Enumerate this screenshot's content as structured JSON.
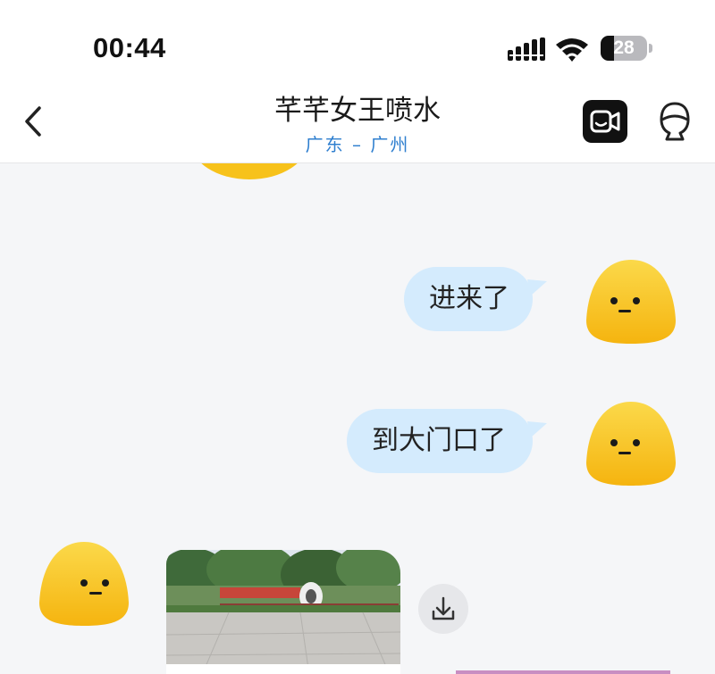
{
  "status_bar": {
    "time": "00:44",
    "battery_level": "28",
    "battery_fraction": 0.28
  },
  "header": {
    "title": "芊芊女王喷水",
    "subtitle": "广东 – 广州",
    "icons": {
      "back": "chevron-left-icon",
      "video": "video-call-icon",
      "profile": "profile-icon"
    }
  },
  "messages": [
    {
      "sender": "me",
      "type": "text",
      "text": "进来了"
    },
    {
      "sender": "me",
      "type": "text",
      "text": "到大门口了"
    },
    {
      "sender": "other",
      "type": "image",
      "image_description_icon": "photo-icon",
      "download_icon": "download-icon"
    }
  ],
  "colors": {
    "bubble_sent": "#d4ebfd",
    "avatar_yellow": "#f7c21b",
    "subtitle_blue": "#2f7fcf",
    "background": "#f5f6f8"
  }
}
